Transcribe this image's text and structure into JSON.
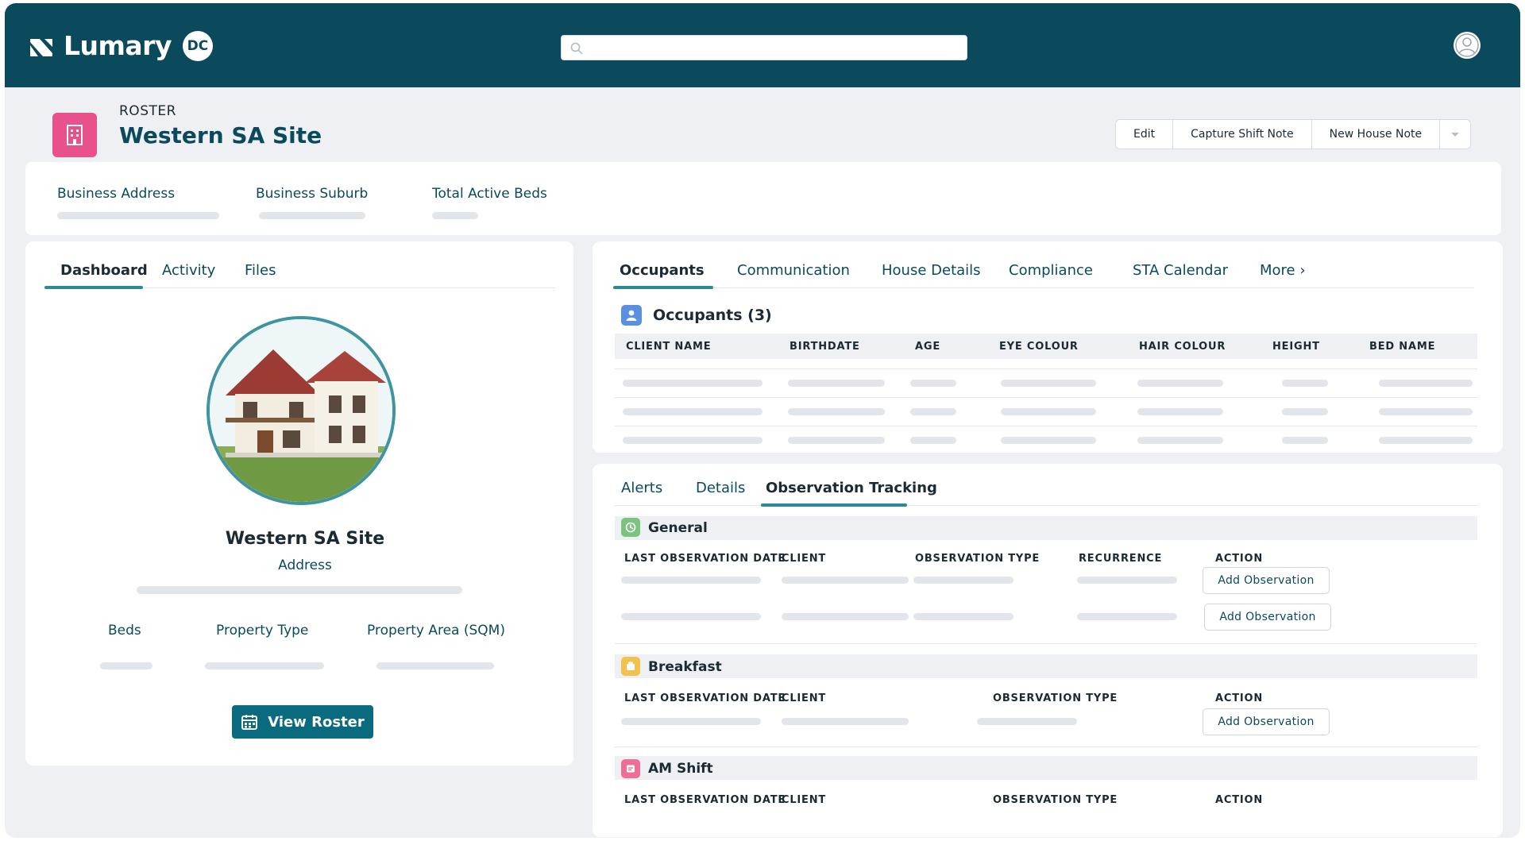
{
  "app": {
    "brand": "Lumary",
    "badge": "DC"
  },
  "record": {
    "kicker": "ROSTER",
    "title": "Western SA Site",
    "actions": [
      "Edit",
      "Capture Shift Note",
      "New House Note"
    ]
  },
  "highlights": [
    "Business Address",
    "Business Suburb",
    "Total Active Beds"
  ],
  "left_tabs": [
    "Dashboard",
    "Activity",
    "Files"
  ],
  "site": {
    "name": "Western SA Site",
    "address_label": "Address",
    "fields": [
      "Beds",
      "Property Type",
      "Property Area (SQM)"
    ],
    "view_roster": "View Roster"
  },
  "right_tabs": [
    "Occupants",
    "Communication",
    "House Details",
    "Compliance",
    "STA Calendar",
    "More ›"
  ],
  "occupants": {
    "title": "Occupants (3)",
    "columns": [
      "CLIENT NAME",
      "BIRTHDATE",
      "AGE",
      "EYE COLOUR",
      "HAIR COLOUR",
      "HEIGHT",
      "BED NAME"
    ]
  },
  "lower_tabs": [
    "Alerts",
    "Details",
    "Observation Tracking"
  ],
  "observations": {
    "add_label": "Add Observation",
    "general": {
      "title": "General",
      "columns": [
        "LAST OBSERVATION DATE",
        "CLIENT",
        "OBSERVATION TYPE",
        "RECURRENCE",
        "ACTION"
      ]
    },
    "breakfast": {
      "title": "Breakfast",
      "columns": [
        "LAST OBSERVATION DATE",
        "CLIENT",
        "OBSERVATION TYPE",
        "ACTION"
      ]
    },
    "am_shift": {
      "title": "AM Shift",
      "columns": [
        "LAST OBSERVATION DATE",
        "CLIENT",
        "OBSERVATION TYPE",
        "ACTION"
      ]
    }
  },
  "colors": {
    "header": "#0a4a5c",
    "accent": "#2b8a94",
    "record_icon": "#e8518b",
    "button": "#0a6a7e"
  }
}
